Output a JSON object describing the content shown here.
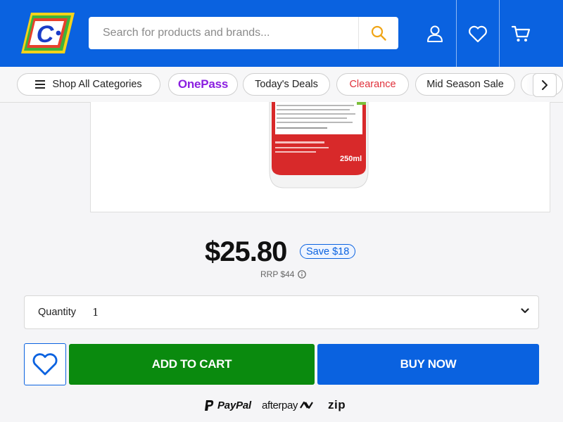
{
  "header": {
    "logo_letter": "C",
    "search": {
      "placeholder": "Search for products and brands..."
    },
    "icons": [
      "search-icon",
      "account-icon",
      "wishlist-icon",
      "cart-icon"
    ]
  },
  "categories": {
    "items": [
      {
        "label": "Shop All Categories"
      },
      {
        "label": "OnePass"
      },
      {
        "label": "Today's Deals"
      },
      {
        "label": "Clearance"
      },
      {
        "label": "Mid Season Sale"
      }
    ]
  },
  "product": {
    "image_label": {
      "line1": "DISTRIBUTED BY: Chemical Essentials (Pty) Ltd.",
      "line2": "Registration Holder:",
      "volume": "250ml"
    },
    "price": "$25.80",
    "save": "Save $18",
    "rrp": "RRP $44",
    "quantity_label": "Quantity",
    "quantity_value": "1"
  },
  "actions": {
    "add_to_cart": "ADD TO CART",
    "buy_now": "BUY NOW"
  },
  "payments": {
    "paypal": "PayPal",
    "afterpay": "afterpay",
    "zip": "zip"
  },
  "colors": {
    "brand_blue": "#0a62e0",
    "cart_green": "#0a8a0e",
    "onepass_purple": "#8b1fe0",
    "clearance_red": "#e0303a"
  }
}
